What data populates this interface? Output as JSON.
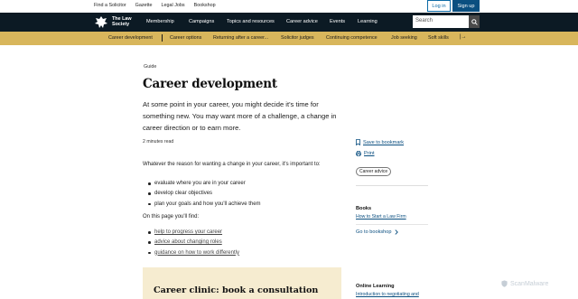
{
  "utility": {
    "links": [
      "Find a Solicitor",
      "Gazette",
      "Legal Jobs",
      "Bookshop"
    ],
    "login_label": "Log in",
    "signup_label": "Sign up"
  },
  "nav": {
    "logo_line1": "The Law",
    "logo_line2": "Society",
    "items": [
      "Membership",
      "Campaigns",
      "Topics and resources",
      "Career advice",
      "Events",
      "Learning"
    ],
    "search_placeholder": "Search"
  },
  "subnav": {
    "items": [
      "Career development",
      "Career options",
      "Returning after a career...",
      "Solicitor judges",
      "Continuing competence",
      "Job seeking",
      "Soft skills"
    ]
  },
  "content": {
    "crumb": "Guide",
    "title": "Career development",
    "lead": "At some point in your career, you might decide it's time for something new. You may want more of a challenge, a change in career direction or to earn more.",
    "read_time": "2 minutes read",
    "intro": "Whatever the reason for wanting a change in your career, it's important to:",
    "bullets": [
      "evaluate where you are in your career",
      "develop clear objectives",
      "plan your goals and how you'll achieve them"
    ],
    "on_page": "On this page you'll find:",
    "page_links": [
      "help to progress your career",
      "advice about changing roles",
      "guidance on how to work differently"
    ],
    "clinic_title": "Career clinic: book a consultation"
  },
  "sidebar": {
    "bookmark": "Save to bookmark",
    "print": "Print",
    "tag": "Career advice",
    "books_heading": "Books",
    "books_link": "How to Start a Law Firm",
    "goto_bookshop": "Go to bookshop",
    "online_heading": "Online Learning",
    "online_link": "Introduction to negotiating and"
  },
  "watermark": "ScanMalware",
  "colors": {
    "nav_bg": "#0c1a24",
    "subnav_bg": "#d8b65c",
    "accent_blue": "#0b4f80",
    "clinic_bg": "#f6ecd0"
  }
}
